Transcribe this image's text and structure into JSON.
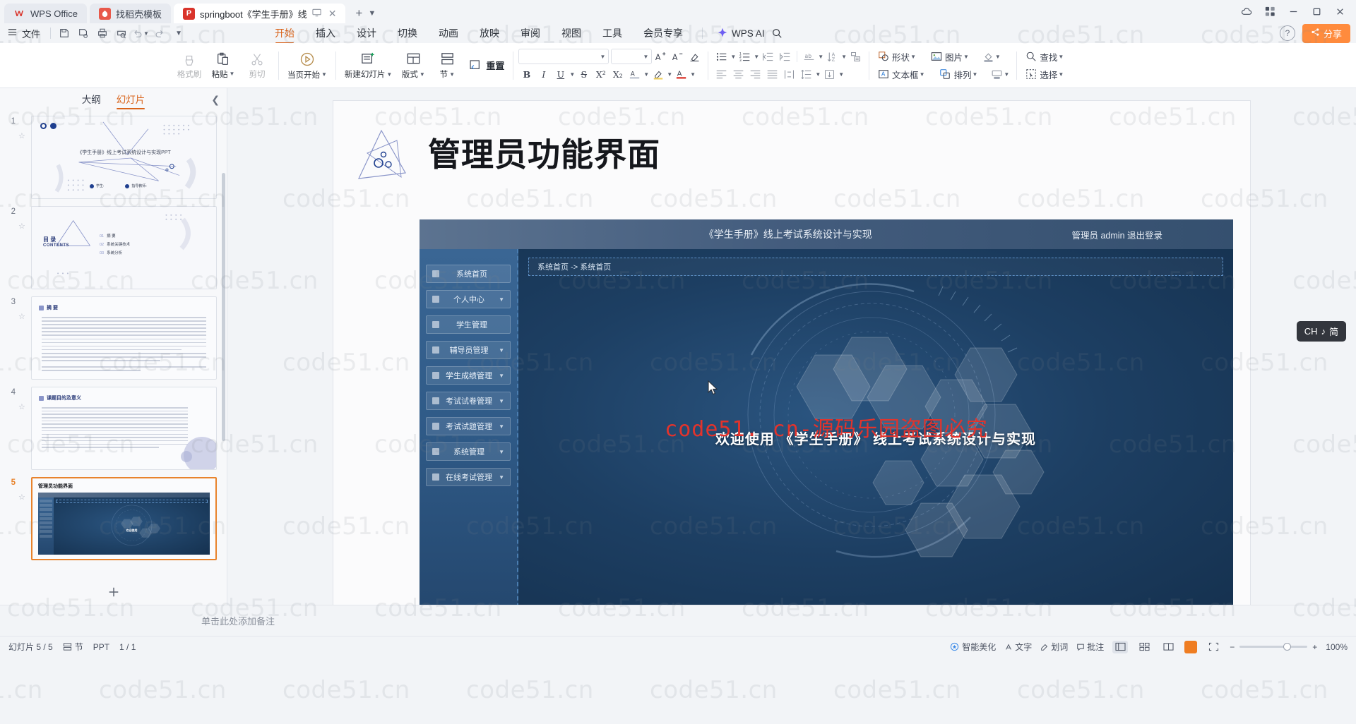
{
  "app": {
    "name": "WPS Office"
  },
  "titlebar": {
    "tabs": [
      {
        "label": "WPS Office",
        "icon": "wps-logo-icon",
        "type": "home"
      },
      {
        "label": "找稻壳模板",
        "icon": "template-icon",
        "type": "normal"
      },
      {
        "label": "springboot《学生手册》线",
        "icon": "ppt-icon",
        "type": "active"
      }
    ],
    "new_tab": "+",
    "window_buttons": [
      "minimize",
      "maximize",
      "close"
    ]
  },
  "menubar": {
    "file_label": "文件",
    "quick_access": [
      "save-icon",
      "save-as-icon",
      "print-icon",
      "print-preview-icon",
      "undo-icon",
      "redo-icon",
      "customize-icon"
    ],
    "ribbon_tabs": [
      {
        "label": "开始",
        "active": true
      },
      {
        "label": "插入",
        "active": false
      },
      {
        "label": "设计",
        "active": false
      },
      {
        "label": "切换",
        "active": false
      },
      {
        "label": "动画",
        "active": false
      },
      {
        "label": "放映",
        "active": false
      },
      {
        "label": "审阅",
        "active": false
      },
      {
        "label": "视图",
        "active": false
      },
      {
        "label": "工具",
        "active": false
      },
      {
        "label": "会员专享",
        "active": false
      }
    ],
    "ai_label": "WPS AI",
    "search_icon": "search-icon",
    "help_icon": "help-icon",
    "share_label": "分享"
  },
  "ribbon": {
    "groups": [
      {
        "buttons": [
          {
            "label": "格式刷",
            "icon": "format-painter-icon",
            "caret": true,
            "dim": true
          },
          {
            "label": "粘贴",
            "icon": "paste-icon",
            "caret": true
          },
          {
            "label": "剪切",
            "icon": "cut-icon",
            "dim": true
          }
        ]
      },
      {
        "buttons": [
          {
            "label": "当页开始",
            "icon": "play-from-current-icon",
            "caret": true
          }
        ]
      },
      {
        "buttons": [
          {
            "label": "新建幻灯片",
            "icon": "new-slide-icon",
            "caret": true
          },
          {
            "label": "版式",
            "icon": "layout-icon",
            "caret": true
          },
          {
            "label": "节",
            "icon": "section-icon",
            "caret": true
          },
          {
            "label": "重置",
            "icon": "reset-icon",
            "caret": false
          }
        ]
      }
    ],
    "font": {
      "name": "",
      "size": "",
      "grow": "A+",
      "shrink": "A-",
      "clear": "clear-format-icon"
    },
    "format_row1": [
      "bold-B",
      "italic-I",
      "underline-U",
      "strikethrough-S",
      "superscript",
      "subscript",
      "text-highlight",
      "font-color"
    ],
    "format_row2": [
      "align-left",
      "align-center",
      "align-right",
      "justify",
      "distribute",
      "line-spacing",
      "text-direction"
    ],
    "list_row": [
      "bullets",
      "numbering",
      "decrease-indent",
      "increase-indent",
      "text-effect",
      "sort",
      "smartart"
    ],
    "insert_row1": [
      {
        "label": "形状",
        "icon": "shapes-icon",
        "caret": true
      },
      {
        "label": "图片",
        "icon": "picture-icon",
        "caret": true
      },
      {
        "label": "",
        "icon": "fill-color-icon",
        "caret": true
      }
    ],
    "insert_row2": [
      {
        "label": "文本框",
        "icon": "textbox-icon",
        "caret": true
      },
      {
        "label": "排列",
        "icon": "arrange-icon",
        "caret": true
      },
      {
        "label": "",
        "icon": "shape-style-icon",
        "caret": true
      }
    ],
    "edit_row": [
      {
        "label": "查找",
        "icon": "search-icon",
        "caret": true
      },
      {
        "label": "选择",
        "icon": "select-icon",
        "caret": true
      }
    ]
  },
  "slide_panel": {
    "tabs": [
      {
        "label": "大纲",
        "active": false
      },
      {
        "label": "幻灯片",
        "active": true
      }
    ],
    "collapse_icon": "chevron-left-icon",
    "add_slide_icon": "plus-icon",
    "slides": [
      {
        "number": "1",
        "title": "《学生手册》线上考试系统设计与实现PPT",
        "legend_a": "学生:",
        "legend_b": "指导教师:",
        "active": false
      },
      {
        "number": "2",
        "title": "目录 CONTENTS",
        "items": [
          "摘 要",
          "系统关键技术",
          "系统分析"
        ],
        "nums": [
          "01",
          "02",
          "03"
        ],
        "active": false
      },
      {
        "number": "3",
        "title": "摘 要",
        "active": false
      },
      {
        "number": "4",
        "title": "课题目的及意义",
        "active": false
      },
      {
        "number": "5",
        "title": "管理员功能界面",
        "active": true
      }
    ]
  },
  "slide": {
    "title": "管理员功能界面",
    "app_screenshot": {
      "top_title": "《学生手册》线上考试系统设计与实现",
      "top_right": "管理员 admin 退出登录",
      "breadcrumb": "系统首页  ->  系统首页",
      "menu_items": [
        {
          "label": "系统首页",
          "caret": false
        },
        {
          "label": "个人中心",
          "caret": true
        },
        {
          "label": "学生管理",
          "caret": false
        },
        {
          "label": "辅导员管理",
          "caret": true
        },
        {
          "label": "学生成绩管理",
          "caret": true
        },
        {
          "label": "考试试卷管理",
          "caret": true
        },
        {
          "label": "考试试题管理",
          "caret": true
        },
        {
          "label": "系统管理",
          "caret": true
        },
        {
          "label": "在线考试管理",
          "caret": true
        }
      ],
      "welcome": "欢迎使用 《学生手册》 线上考试系统设计与实现"
    },
    "red_watermark": "code51. cn-源码乐园盗图必究"
  },
  "ime": {
    "label": "CH",
    "mode": "简",
    "music_icon": "music-note-icon"
  },
  "notes": {
    "placeholder": "单击此处添加备注"
  },
  "status": {
    "left": "幻灯片 5 / 5",
    "section": "节",
    "filetype": "PPT",
    "count": "1 / 1",
    "spellcheck": "智能美化",
    "tools": [
      "文字",
      "划词",
      "批注"
    ],
    "zoom": "100%",
    "views": [
      "normal-view",
      "sorter-view",
      "reading-view",
      "slideshow-view"
    ],
    "fit_icon": "fit-to-window-icon"
  },
  "watermark": {
    "text": "code51.cn"
  },
  "colors": {
    "accent_orange": "#d9631a",
    "share_orange": "#ff8b3d",
    "red_watermark": "#e2332c",
    "app_blue": "#1d3f63",
    "panel_bg": "#f2f4f7"
  }
}
